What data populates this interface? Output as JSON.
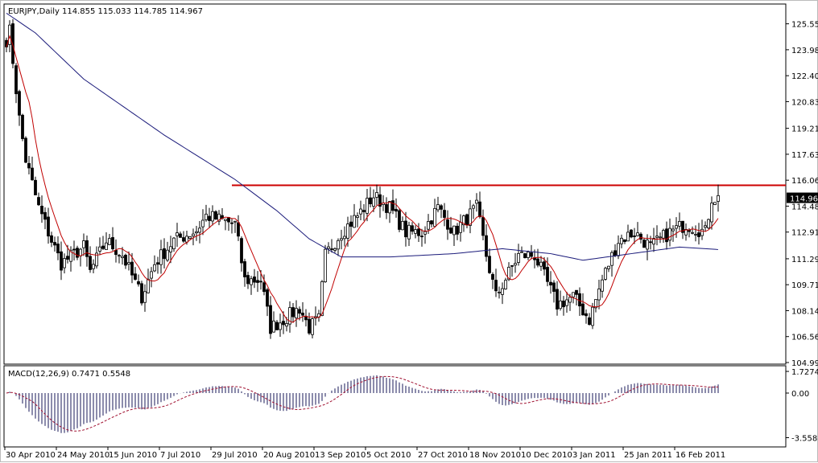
{
  "header": {
    "title": "EURJPY,Daily",
    "ohlc": "114.855 115.033 114.785 114.967"
  },
  "macd_header": {
    "title": "MACD(12,26,9)",
    "values": "0.7471 0.5548"
  },
  "chart_data": [
    {
      "type": "candlestick",
      "symbol": "EURJPY",
      "timeframe": "Daily",
      "ylim": [
        104.99,
        126.3
      ],
      "y_ticks": [
        "125.555",
        "123.980",
        "122.405",
        "120.830",
        "119.210",
        "117.635",
        "116.060",
        "114.485",
        "112.910",
        "111.290",
        "109.715",
        "108.140",
        "106.565",
        "104.990"
      ],
      "current_price": "114.967",
      "x_ticks": [
        {
          "bar": 0,
          "label": "30 Apr 2010"
        },
        {
          "bar": 16,
          "label": "24 May 2010"
        },
        {
          "bar": 32,
          "label": "15 Jun 2010"
        },
        {
          "bar": 48,
          "label": "7 Jul 2010"
        },
        {
          "bar": 64,
          "label": "29 Jul 2010"
        },
        {
          "bar": 80,
          "label": "20 Aug 2010"
        },
        {
          "bar": 96,
          "label": "13 Sep 2010"
        },
        {
          "bar": 112,
          "label": "5 Oct 2010"
        },
        {
          "bar": 128,
          "label": "27 Oct 2010"
        },
        {
          "bar": 144,
          "label": "18 Nov 2010"
        },
        {
          "bar": 160,
          "label": "10 Dec 2010"
        },
        {
          "bar": 176,
          "label": "3 Jan 2011"
        },
        {
          "bar": 192,
          "label": "25 Jan 2011"
        },
        {
          "bar": 208,
          "label": "16 Feb 2011"
        }
      ],
      "close_path": [
        [
          0,
          124.6
        ],
        [
          1,
          125.1
        ],
        [
          4,
          119.8
        ],
        [
          6,
          117.3
        ],
        [
          10,
          114.4
        ],
        [
          14,
          112.4
        ],
        [
          17,
          111
        ],
        [
          24,
          112
        ],
        [
          26,
          110.5
        ],
        [
          31,
          112.4
        ],
        [
          36,
          111.5
        ],
        [
          42,
          109
        ],
        [
          46,
          111
        ],
        [
          52,
          112.4
        ],
        [
          59,
          113
        ],
        [
          62,
          113.9
        ],
        [
          71,
          113.4
        ],
        [
          74,
          110
        ],
        [
          79,
          110
        ],
        [
          82,
          107.1
        ],
        [
          86,
          107.6
        ],
        [
          91,
          108.3
        ],
        [
          94,
          107.1
        ],
        [
          97,
          107.6
        ],
        [
          99,
          111.5
        ],
        [
          104,
          112.9
        ],
        [
          109,
          113.9
        ],
        [
          114,
          115.1
        ],
        [
          119,
          114.4
        ],
        [
          124,
          112.9
        ],
        [
          129,
          112.9
        ],
        [
          134,
          114.4
        ],
        [
          139,
          112.9
        ],
        [
          146,
          114.4
        ],
        [
          149,
          111.5
        ],
        [
          152,
          109
        ],
        [
          159,
          111.5
        ],
        [
          164,
          111.5
        ],
        [
          171,
          108.5
        ],
        [
          176,
          109
        ],
        [
          181,
          107.6
        ],
        [
          185,
          110
        ],
        [
          190,
          112.4
        ],
        [
          195,
          112.9
        ],
        [
          200,
          112
        ],
        [
          206,
          112.9
        ],
        [
          211,
          113.4
        ],
        [
          217,
          112.9
        ],
        [
          219,
          115
        ],
        [
          221,
          114.967
        ]
      ],
      "ma_long_path": [
        [
          0,
          126.2
        ],
        [
          9,
          125
        ],
        [
          24,
          122.2
        ],
        [
          49,
          118.8
        ],
        [
          71,
          116.1
        ],
        [
          84,
          114.2
        ],
        [
          94,
          112.5
        ],
        [
          104,
          111.4
        ],
        [
          119,
          111.4
        ],
        [
          139,
          111.6
        ],
        [
          154,
          111.9
        ],
        [
          169,
          111.6
        ],
        [
          179,
          111.2
        ],
        [
          194,
          111.6
        ],
        [
          209,
          112
        ],
        [
          221,
          111.85
        ]
      ],
      "ma_short_period": 8,
      "resistance": {
        "price": 115.75,
        "from_bar": 70
      },
      "colors": {
        "candle": "#000000",
        "ma_short": "#c00000",
        "ma_long": "#1a1a7a",
        "resistance": "#cc0000"
      }
    },
    {
      "type": "macd",
      "params": [
        12,
        26,
        9
      ],
      "ylim": [
        -3.558,
        1.7274
      ],
      "y_ticks": [
        "1.7274",
        "0.00",
        "-3.558"
      ],
      "colors": {
        "histogram": "#1a1a5a",
        "signal": "#a01030"
      }
    }
  ]
}
